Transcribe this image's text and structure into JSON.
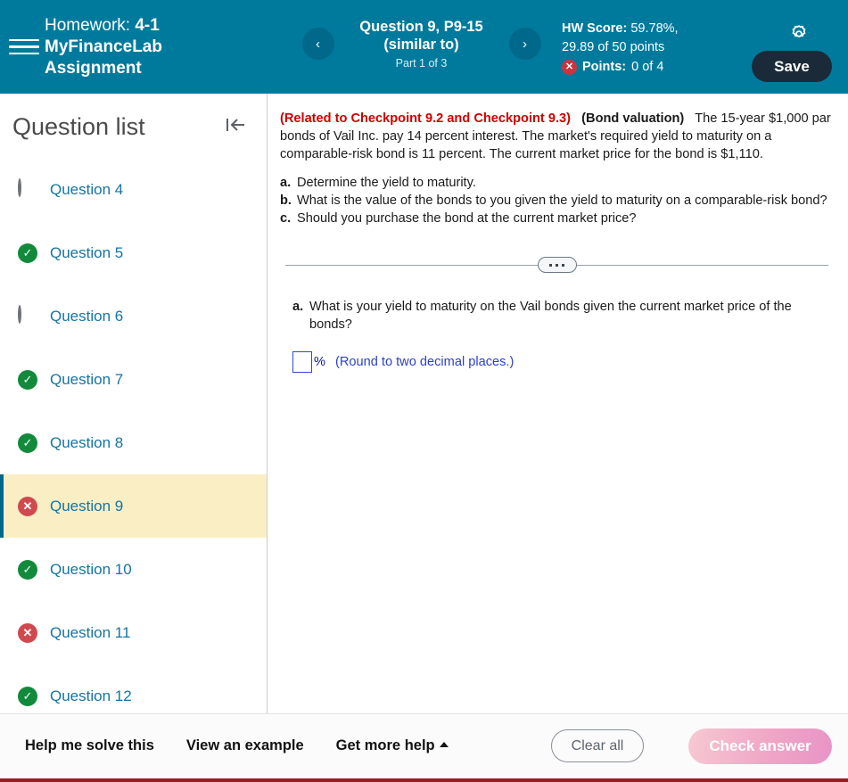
{
  "header": {
    "menu_icon": "hamburger-icon",
    "homework_label": "Homework:",
    "homework_value": "4-1 MyFinanceLab Assignment",
    "prev_icon": "chevron-left-icon",
    "next_icon": "chevron-right-icon",
    "question_title": "Question 9, P9-15",
    "question_subtitle": "(similar to)",
    "part_label": "Part 1 of 3",
    "hw_score_label": "HW Score:",
    "hw_score_value": "59.78%,",
    "hw_points_line": "29.89 of 50 points",
    "points_badge_icon": "x-circle-icon",
    "points_label": "Points:",
    "points_value": "0 of 4",
    "gear_icon": "gear-icon",
    "save_label": "Save",
    "bg_color": "#007A9C",
    "save_bg_color": "#1b2a38"
  },
  "sidebar": {
    "title": "Question list",
    "collapse_icon": "collapse-left-icon",
    "items": [
      {
        "label": "Question 4",
        "status": "unanswered",
        "status_icon": "empty-circle-icon",
        "active": false
      },
      {
        "label": "Question 5",
        "status": "correct",
        "status_icon": "check-circle-icon",
        "active": false
      },
      {
        "label": "Question 6",
        "status": "unanswered",
        "status_icon": "empty-circle-icon",
        "active": false
      },
      {
        "label": "Question 7",
        "status": "correct",
        "status_icon": "check-circle-icon",
        "active": false
      },
      {
        "label": "Question 8",
        "status": "correct",
        "status_icon": "check-circle-icon",
        "active": false
      },
      {
        "label": "Question 9",
        "status": "incorrect",
        "status_icon": "x-circle-icon",
        "active": true
      },
      {
        "label": "Question 10",
        "status": "correct",
        "status_icon": "check-circle-icon",
        "active": false
      },
      {
        "label": "Question 11",
        "status": "incorrect",
        "status_icon": "x-circle-icon",
        "active": false
      },
      {
        "label": "Question 12",
        "status": "correct",
        "status_icon": "check-circle-icon",
        "active": false
      }
    ],
    "active_bg_color": "#faeec4",
    "link_color": "#1474a4",
    "correct_color": "#128a3c",
    "incorrect_color": "#cf4a4f"
  },
  "question": {
    "checkpoint_note": "(Related to Checkpoint 9.2 and Checkpoint 9.3)",
    "topic": "(Bond valuation)",
    "body": "The 15-year $1,000 par bonds of Vail Inc. pay 14 percent interest.  The market's required yield to maturity on a comparable-risk bond is 11 percent.  The current market price for the bond is $1,110.",
    "subparts": [
      {
        "letter": "a.",
        "text": "Determine the yield to maturity."
      },
      {
        "letter": "b.",
        "text": "What is the value of the bonds to you given the yield to maturity on a comparable-risk bond?"
      },
      {
        "letter": "c.",
        "text": "Should you purchase the bond at the current market price?"
      }
    ],
    "checkpoint_color": "#d00000"
  },
  "divider": {
    "handle_icon": "drag-handle-dots-icon"
  },
  "answer": {
    "letter": "a.",
    "prompt": "What is your yield to maturity on the Vail bonds given the current market price of the bonds?",
    "input_value": "",
    "input_placeholder": "",
    "unit": "%",
    "hint": "(Round to two decimal places.)",
    "input_border_color": "#2a4adf",
    "hint_color": "#2a3fd0"
  },
  "footer": {
    "help_solve": "Help me solve this",
    "view_example": "View an example",
    "get_more_help": "Get more help",
    "get_more_help_icon": "caret-up-icon",
    "clear_all": "Clear all",
    "check_answer": "Check answer",
    "check_answer_disabled": true
  }
}
